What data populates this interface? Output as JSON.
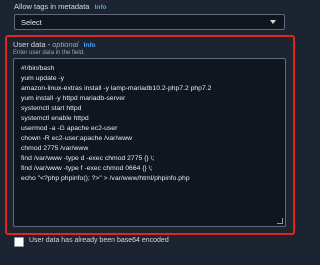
{
  "metadata_tags": {
    "label": "Allow tags in metadata",
    "info": "Info",
    "select_value": "Select"
  },
  "user_data": {
    "label": "User data",
    "optional": "optional",
    "info": "Info",
    "hint": "Enter user data in the field.",
    "lines": [
      "#!/bin/bash",
      "yum update -y",
      "amazon-linux-extras install -y lamp-mariadb10.2-php7.2 php7.2",
      "yum install -y httpd mariadb-server",
      "systemctl start httpd",
      "systemctl enable httpd",
      "usermod -a -G apache ec2-user",
      "chown -R ec2-user:apache /var/www",
      "chmod 2775 /var/www",
      "find /var/www -type d -exec chmod 2775 {} \\;",
      "find /var/www -type f -exec chmod 0664 {} \\;",
      "echo \"<?php phpinfo(); ?>\" > /var/www/html/phpinfo.php"
    ]
  },
  "base64_checkbox": {
    "label": "User data has already been base64 encoded",
    "checked": false
  },
  "colors": {
    "background": "#1b2430",
    "highlight": "#e0261f",
    "link": "#539fe5"
  }
}
